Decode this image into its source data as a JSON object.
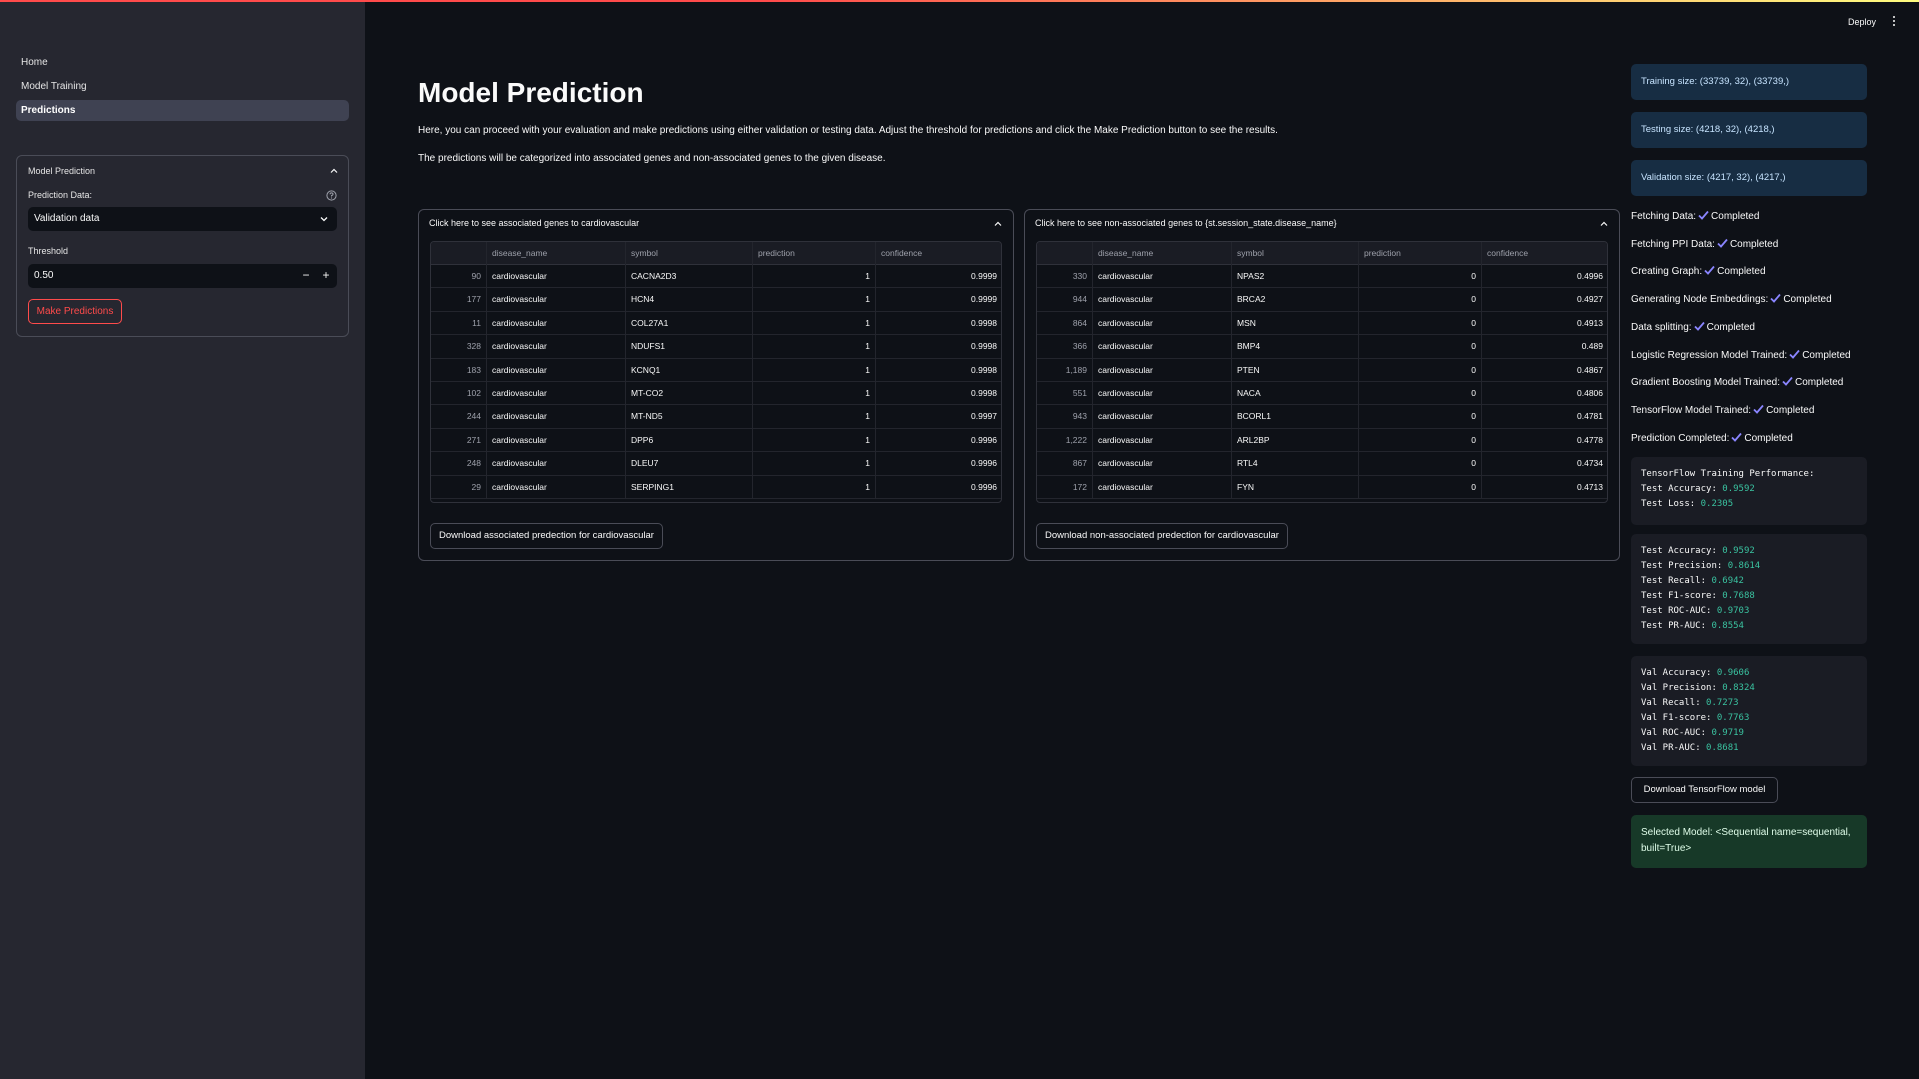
{
  "sidebar": {
    "nav": [
      "Home",
      "Model Training",
      "Predictions"
    ],
    "active_index": 2,
    "panel": {
      "title": "Model Prediction",
      "prediction_label": "Prediction Data:",
      "prediction_value": "Validation data",
      "threshold_label": "Threshold",
      "threshold_value": "0.50",
      "minus": "−",
      "plus": "+",
      "button": "Make Predictions"
    }
  },
  "header": {
    "deploy": "Deploy"
  },
  "main": {
    "title": "Model Prediction",
    "para1": "Here, you can proceed with your evaluation and make predictions using either validation or testing data. Adjust the threshold for predictions and click the Make Prediction button to see the results.",
    "para2": "The predictions will be categorized into associated genes and non-associated genes to the given disease."
  },
  "tables": [
    {
      "title": "Click here to see associated genes to cardiovascular",
      "columns": [
        "",
        "disease_name",
        "symbol",
        "prediction",
        "confidence"
      ],
      "rows": [
        [
          "90",
          "cardiovascular",
          "CACNA2D3",
          "1",
          "0.9999"
        ],
        [
          "177",
          "cardiovascular",
          "HCN4",
          "1",
          "0.9999"
        ],
        [
          "11",
          "cardiovascular",
          "COL27A1",
          "1",
          "0.9998"
        ],
        [
          "328",
          "cardiovascular",
          "NDUFS1",
          "1",
          "0.9998"
        ],
        [
          "183",
          "cardiovascular",
          "KCNQ1",
          "1",
          "0.9998"
        ],
        [
          "102",
          "cardiovascular",
          "MT-CO2",
          "1",
          "0.9998"
        ],
        [
          "244",
          "cardiovascular",
          "MT-ND5",
          "1",
          "0.9997"
        ],
        [
          "271",
          "cardiovascular",
          "DPP6",
          "1",
          "0.9996"
        ],
        [
          "248",
          "cardiovascular",
          "DLEU7",
          "1",
          "0.9996"
        ],
        [
          "29",
          "cardiovascular",
          "SERPING1",
          "1",
          "0.9996"
        ]
      ],
      "button": "Download associated predection for cardiovascular"
    },
    {
      "title": "Click here to see non-associated genes to {st.session_state.disease_name}",
      "columns": [
        "",
        "disease_name",
        "symbol",
        "prediction",
        "confidence"
      ],
      "rows": [
        [
          "330",
          "cardiovascular",
          "NPAS2",
          "0",
          "0.4996"
        ],
        [
          "944",
          "cardiovascular",
          "BRCA2",
          "0",
          "0.4927"
        ],
        [
          "864",
          "cardiovascular",
          "MSN",
          "0",
          "0.4913"
        ],
        [
          "366",
          "cardiovascular",
          "BMP4",
          "0",
          "0.489"
        ],
        [
          "1,189",
          "cardiovascular",
          "PTEN",
          "0",
          "0.4867"
        ],
        [
          "551",
          "cardiovascular",
          "NACA",
          "0",
          "0.4806"
        ],
        [
          "943",
          "cardiovascular",
          "BCORL1",
          "0",
          "0.4781"
        ],
        [
          "1,222",
          "cardiovascular",
          "ARL2BP",
          "0",
          "0.4778"
        ],
        [
          "867",
          "cardiovascular",
          "RTL4",
          "0",
          "0.4734"
        ],
        [
          "172",
          "cardiovascular",
          "FYN",
          "0",
          "0.4713"
        ]
      ],
      "button": "Download non-associated predection for cardiovascular"
    }
  ],
  "info": [
    "Training size: (33739, 32), (33739,)",
    "Testing size: (4218, 32), (4218,)",
    "Validation size: (4217, 32), (4217,)"
  ],
  "status": [
    {
      "label": "Fetching Data:",
      "value": "Completed"
    },
    {
      "label": "Fetching PPI Data:",
      "value": "Completed"
    },
    {
      "label": "Creating Graph:",
      "value": "Completed"
    },
    {
      "label": "Generating Node Embeddings:",
      "value": "Completed"
    },
    {
      "label": "Data splitting:",
      "value": "Completed"
    },
    {
      "label": "Logistic Regression Model Trained:",
      "value": "Completed"
    },
    {
      "label": "Gradient Boosting Model Trained:",
      "value": "Completed"
    },
    {
      "label": "TensorFlow Model Trained:",
      "value": "Completed"
    },
    {
      "label": "Prediction Completed:",
      "value": "Completed"
    }
  ],
  "code_blocks": [
    {
      "heading": "TensorFlow Training Performance:",
      "lines": [
        {
          "label": "Test Accuracy",
          "value": "0.9592"
        },
        {
          "label": "Test Loss",
          "value": "0.2305"
        }
      ]
    },
    {
      "heading": "",
      "lines": [
        {
          "label": "Test Accuracy",
          "value": "0.9592"
        },
        {
          "label": "Test Precision",
          "value": "0.8614"
        },
        {
          "label": "Test Recall",
          "value": "0.6942"
        },
        {
          "label": "Test F1-score",
          "value": "0.7688"
        },
        {
          "label": "Test ROC-AUC",
          "value": "0.9703"
        },
        {
          "label": "Test PR-AUC",
          "value": "0.8554"
        }
      ]
    },
    {
      "heading": "",
      "lines": [
        {
          "label": "Val Accuracy",
          "value": "0.9606"
        },
        {
          "label": "Val Precision",
          "value": "0.8324"
        },
        {
          "label": "Val Recall",
          "value": "0.7273"
        },
        {
          "label": "Val F1-score",
          "value": "0.7763"
        },
        {
          "label": "Val ROC-AUC",
          "value": "0.9719"
        },
        {
          "label": "Val PR-AUC",
          "value": "0.8681"
        }
      ]
    }
  ],
  "tf_button": "Download TensorFlow model",
  "success": "Selected Model: <Sequential name=sequential, built=True>",
  "colors": {
    "accent": "#ff4b4b",
    "check": "#8a85ff",
    "metric": "#3ac2a0",
    "info_bg": "#172d43",
    "success_bg": "#173928"
  }
}
